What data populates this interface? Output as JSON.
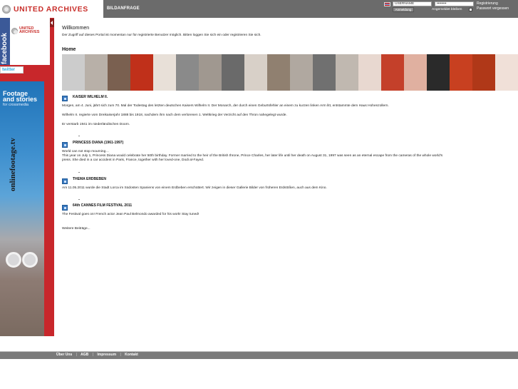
{
  "header": {
    "logo_text": "UNITED ARCHIVES",
    "nav_bildanfrage": "BILDANFRAGE",
    "username_value": "USERNAME",
    "password_value": "••••••••",
    "login_button": "Anmeldung",
    "remember_label": "Angemeldet bleiben",
    "register_link": "Registrierung",
    "forgot_link": "Passwort vergessen"
  },
  "sidebar": {
    "facebook_label": "facebook",
    "facebook_logo_line1": "UNITED",
    "facebook_logo_line2": "ARCHIVES",
    "twitter_label": "twitter",
    "promo_line1": "Footage",
    "promo_line2": "and stories",
    "promo_line3": "for crossmedia",
    "promo_url": "onlinefootage.tv"
  },
  "main": {
    "welcome_title": "Willkommen",
    "welcome_text": "Der Zugriff auf dieses Portal ist momentan nur für registrierte Benutzer möglich. Bitten loggen Sie sich ein oder registrieren Sie sich.",
    "home_title": "Home",
    "strip_colors": [
      "#ccc",
      "#b8b0a8",
      "#7a6050",
      "#c0301a",
      "#e8e0d8",
      "#8a8a8a",
      "#a09890",
      "#6a6a6a",
      "#d8d0c8",
      "#908070",
      "#b0a8a0",
      "#707070",
      "#c0b8b0",
      "#e8d8d0",
      "#c4402a",
      "#e0b0a0",
      "#2a2a2a",
      "#c84020",
      "#b03818",
      "#f0e0d8"
    ],
    "articles": [
      {
        "title": "KAISER WILHELM II.",
        "paragraphs": [
          "Morgen, am 4. Juni, jährt sich zum 70. Mal der Todestag des letzten deutschen Kaisers Wilhelm II. Der Monarch, der durch einen Geburtsfehler an einem zu kurzen linken Arm litt, entstammte dem Haus Hohenzollern.",
          "Wilhelm II. regierte vom Dreikaiserjahr 1888 bis 1918, nachdem ihm nach dem verlorenen 1. Weltkrieg der Verzicht auf den Thron nahegelegt wurde.",
          "Er verstarb 1941 im niederländischen Doorn."
        ]
      },
      {
        "title": "PRINCESS DIANA (1961-1997)",
        "paragraphs": [
          "World can not stop mourning…",
          "This year on July 1, Princess Diana would celebrate her 50th birthday. Former married to the heir of the British throne, Prince Charles, her later life until her death on August 31, 1997 was seen as an eternal escape from the cameras of the whole world's",
          "press. She died in a car accident in Paris, France, together with her loved-one, Dodi al-Fayed."
        ]
      },
      {
        "title": "THEMA ERDBEBEN",
        "paragraphs": [
          "Am 11.05.2011 wurde die Stadt Lorca im Südosten Spaniens von einem Erdbeben erschüttert. Wir zeigen in dieser Gallerie Bilder von früheren Erdstößen, auch aus dem Kino."
        ]
      },
      {
        "title": "64th CANNES FILM FESTIVAL 2011",
        "paragraphs": [
          "The Festival goes on! French actor Jean Paul Belmondo awarded for his work! Stay tuned!"
        ]
      }
    ],
    "more_link": "Weitere Beiträge..."
  },
  "footer": {
    "links": [
      "Über Uns",
      "AGB",
      "Impressum",
      "Kontakt"
    ],
    "separator": "|"
  }
}
